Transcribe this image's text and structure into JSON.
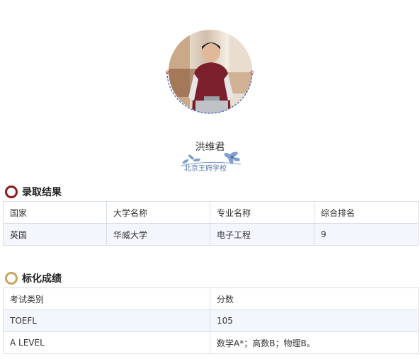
{
  "student": {
    "name": "洪维君"
  },
  "school_logo": {
    "text": "北京王府学校"
  },
  "admission": {
    "title": "录取结果",
    "headers": [
      "国家",
      "大学名称",
      "专业名称",
      "综合排名"
    ],
    "rows": [
      [
        "英国",
        "华威大学",
        "电子工程",
        "9"
      ]
    ]
  },
  "scores": {
    "title": "标化成绩",
    "headers": [
      "考试类别",
      "分数"
    ],
    "rows": [
      [
        "TOEFL",
        "105"
      ],
      [
        "A LEVEL",
        "数学A*；高数B；物理B。"
      ]
    ]
  },
  "colors": {
    "admission_ring": "#8b1a1a",
    "scores_ring": "#c8a55a",
    "table_border": "#d9dfe7",
    "row_tint": "#f3f7fd"
  }
}
